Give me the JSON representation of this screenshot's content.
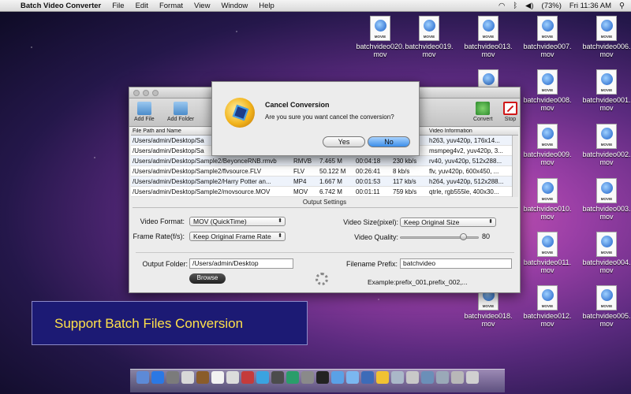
{
  "menubar": {
    "app_name": "Batch Video Converter",
    "menus": [
      "File",
      "Edit",
      "Format",
      "View",
      "Window",
      "Help"
    ],
    "status_battery": "(73%)",
    "clock": "Fri 11:36 AM"
  },
  "desktop_icons": [
    {
      "label": "batchvideo020.\nmov"
    },
    {
      "label": "batchvideo019.\nmov"
    },
    {
      "label": "batchvideo013.\nmov"
    },
    {
      "label": "batchvideo007.\nmov"
    },
    {
      "label": "batchvideo006.\nmov"
    },
    {
      "label": "batchvideo008.\nmov"
    },
    {
      "label": "batchvideo001.\nmov"
    },
    {
      "label": "batchvideo009.\nmov"
    },
    {
      "label": "batchvideo002.\nmov"
    },
    {
      "label": "batchvideo010.\nmov"
    },
    {
      "label": "batchvideo003.\nmov"
    },
    {
      "label": "batchvideo011.\nmov"
    },
    {
      "label": "batchvideo004.\nmov"
    },
    {
      "label": "batchvideo018.\nmov"
    },
    {
      "label": "batchvideo012.\nmov"
    },
    {
      "label": "batchvideo005.\nmov"
    }
  ],
  "icon_tag": "MOVIE",
  "window": {
    "toolbar": {
      "add_file": "Add File",
      "add_folder": "Add Folder",
      "convert": "Convert",
      "stop": "Stop"
    },
    "table": {
      "headers": [
        "File Path and Name",
        "",
        "",
        "",
        "",
        "Video Information"
      ],
      "rows": [
        [
          "/Users/admin/Desktop/Sa",
          "",
          "",
          "",
          "",
          "h263, yuv420p, 176x14..."
        ],
        [
          "/Users/admin/Desktop/Sa",
          "",
          "",
          "",
          "",
          "msmpeg4v2, yuv420p, 3..."
        ],
        [
          "/Users/admin/Desktop/Sample2/BeyonceRNB.rmvb",
          "RMVB",
          "7.465 M",
          "00:04:18",
          "230 kb/s",
          "rv40, yuv420p, 512x288..."
        ],
        [
          "/Users/admin/Desktop/Sample2/flvsource.FLV",
          "FLV",
          "50.122 M",
          "00:26:41",
          "8 kb/s",
          "flv, yuv420p, 600x450, ..."
        ],
        [
          "/Users/admin/Desktop/Sample2/Harry Potter an...",
          "MP4",
          "1.667 M",
          "00:01:53",
          "117 kb/s",
          "h264, yuv420p, 512x288..."
        ],
        [
          "/Users/admin/Desktop/Sample2/movsource.MOV",
          "MOV",
          "6.742 M",
          "00:01:11",
          "759 kb/s",
          "qtrle, rgb555le, 400x30..."
        ]
      ]
    },
    "settings": {
      "title": "Output Settings",
      "video_format_label": "Video Format:",
      "video_format_value": "MOV (QuickTime)",
      "frame_rate_label": "Frame Rate(f/s):",
      "frame_rate_value": "Keep Original Frame Rate",
      "video_size_label": "Video Size(pixel):",
      "video_size_value": "Keep Original Size",
      "video_quality_label": "Video Quality:",
      "video_quality_value": "80",
      "video_quality_fraction": 0.8,
      "output_folder_label": "Output Folder:",
      "output_folder_value": "/Users/admin/Desktop",
      "browse_label": "Browse",
      "filename_prefix_label": "Filename Prefix:",
      "filename_prefix_value": "batchvideo",
      "example_text": "Example:prefix_001,prefix_002,..."
    }
  },
  "dialog": {
    "title": "Cancel Conversion",
    "message": "Are you sure you want cancel the conversion?",
    "yes_label": "Yes",
    "no_label": "No"
  },
  "banner": {
    "text": "Support Batch Files Conversion"
  }
}
